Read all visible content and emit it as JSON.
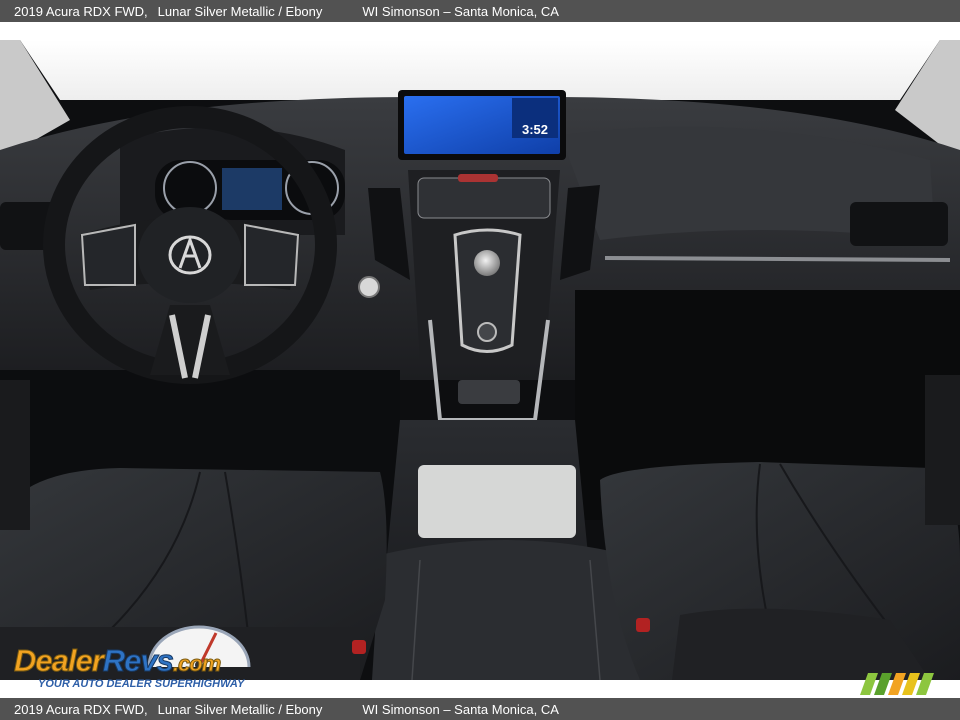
{
  "caption": {
    "vehicle": "2019 Acura RDX FWD,",
    "colors": "Lunar Silver Metallic / Ebony",
    "dealer": "WI Simonson – Santa Monica, CA"
  },
  "screen": {
    "time": "3:52"
  },
  "watermark": {
    "logo_part1": "Dealer",
    "logo_part2": "Revs",
    "logo_part3": ".com",
    "tagline": "YOUR AUTO DEALER SUPERHIGHWAY"
  },
  "colors": {
    "caption_bar": "#525252",
    "screen_blue": "#1f5fd6",
    "leather": "#26282b",
    "logo_orange": "#f2a321",
    "logo_blue": "#2e73c4"
  },
  "icons": [
    "acura-logo-icon",
    "speedometer-icon",
    "tachometer-icon",
    "rotary-knob-icon",
    "gear-badge-icon"
  ]
}
